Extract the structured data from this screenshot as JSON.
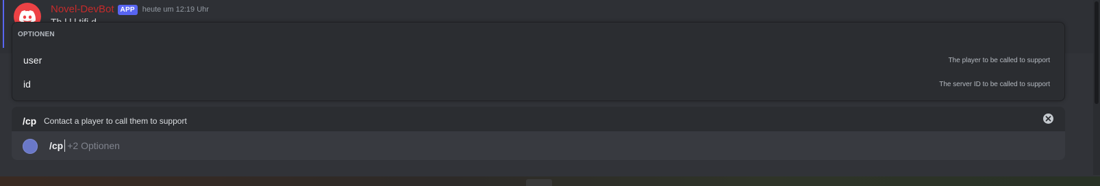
{
  "message": {
    "author": "Novel-DevBot",
    "badge": "APP",
    "timestamp": "heute um 12:19 Uhr",
    "text": "Th   l                         l   l         tifi d",
    "author_color": "#c42b2b",
    "avatar_icon": "discord-logo-icon"
  },
  "options_popup": {
    "heading": "OPTIONEN",
    "options": [
      {
        "name": "user",
        "description": "The player to be called to support"
      },
      {
        "name": "id",
        "description": "The server ID to be called to support"
      }
    ]
  },
  "command_bar": {
    "command": "/cp",
    "description": "Contact a player to call them to support",
    "close_icon": "close-circle-icon"
  },
  "input": {
    "value": "/cp",
    "hint": "+2 Optionen"
  },
  "colors": {
    "accent": "#5865f2",
    "background": "#313338",
    "popup_background": "#2b2d31",
    "input_background": "#383a40"
  }
}
